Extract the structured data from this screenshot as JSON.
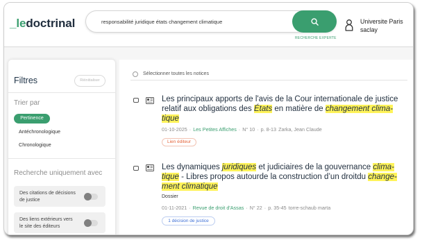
{
  "colors": {
    "accent": "#3a9e6f",
    "title": "#1f2d3d",
    "highlight": "#fff35a",
    "link_badge": "#e4633a",
    "decision_badge": "#3d6fd6"
  },
  "header": {
    "logo": {
      "prefix": "_le",
      "suffix": "doctrinal"
    },
    "search": {
      "query": "responsabilité juridique états changement climatique",
      "button_icon": "search-icon",
      "expert_label": "RECHERCHE EXPERTE"
    },
    "user": {
      "icon": "user-icon",
      "name_line1": "Universite Paris",
      "name_line2": "saclay"
    }
  },
  "filters": {
    "title": "Filtres",
    "reset_label": "Réinitialiser",
    "sort": {
      "title": "Trier par",
      "options": [
        {
          "label": "Pertinence",
          "selected": true
        },
        {
          "label": "Antéchronologique",
          "selected": false
        },
        {
          "label": "Chronologique",
          "selected": false
        }
      ]
    },
    "only_with": {
      "title": "Recherche uniquement avec",
      "toggles": [
        {
          "label_lines": [
            "Des citations de décisions",
            "de justice"
          ],
          "on": false
        },
        {
          "label_lines": [
            "Des liens extérieurs vers",
            "le site des éditeurs"
          ],
          "on": false
        }
      ]
    }
  },
  "results": {
    "select_all_label": "Sélectionner toutes les notices",
    "separator": "·",
    "items": [
      {
        "icon": "document-icon",
        "title_lines": [
          [
            {
              "text": "Les principaux apports de l'avis de la Cour internationale de justice",
              "hl": false
            }
          ],
          [
            {
              "text": "relatif aux obligations des ",
              "hl": false
            },
            {
              "text": "États",
              "hl": true
            },
            {
              "text": " en matière de ",
              "hl": false
            },
            {
              "text": "changement clima-",
              "hl": true
            }
          ],
          [
            {
              "text": "tique",
              "hl": true
            }
          ]
        ],
        "date": "01-10-2025",
        "source": "Les Petites Affiches",
        "number": "N° 10",
        "pages": "p. 8-13",
        "authors": "Zarka, Jean Claude",
        "badge": "Lien éditeur"
      },
      {
        "icon": "document-icon",
        "title_lines": [
          [
            {
              "text": "Les dynamiques ",
              "hl": false
            },
            {
              "text": "juridiques",
              "hl": true
            },
            {
              "text": " et judiciaires de la gouvernance ",
              "hl": false
            },
            {
              "text": "clima-",
              "hl": true
            }
          ],
          [
            {
              "text": "tique",
              "hl": true
            },
            {
              "text": " - Libres propos autourde la construction d’un droitdu ",
              "hl": false
            },
            {
              "text": "change-",
              "hl": true
            }
          ],
          [
            {
              "text": "ment climatique",
              "hl": true
            }
          ]
        ],
        "type": "Dossier",
        "date": "01-11-2021",
        "source": "Revue de droit d'Assas",
        "number": "N° 22",
        "pages": "p. 35-45",
        "authors": "torre-schaub marta",
        "badge": "1 décision de justice"
      }
    ]
  }
}
